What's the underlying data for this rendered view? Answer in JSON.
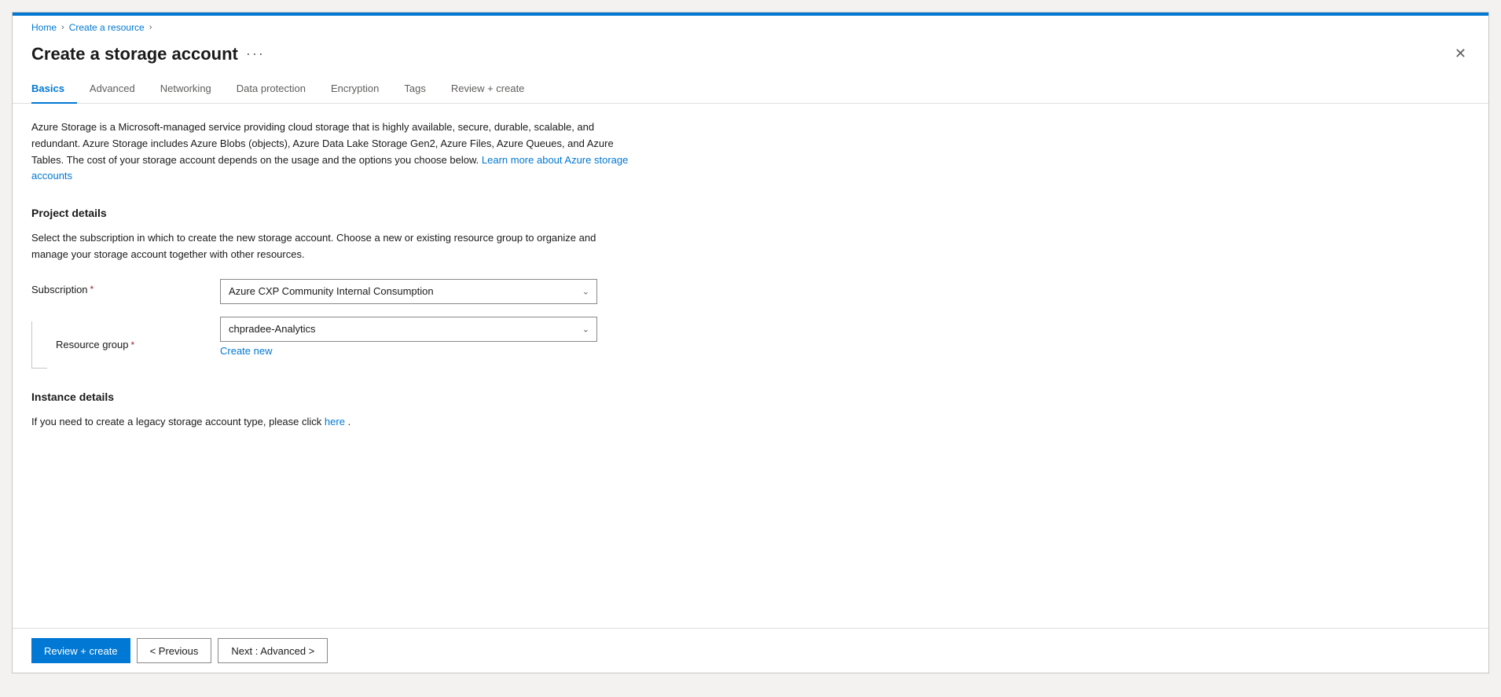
{
  "breadcrumb": {
    "home": "Home",
    "create_resource": "Create a resource",
    "chevron1": "›",
    "chevron2": "›"
  },
  "title": "Create a storage account",
  "title_dots": "···",
  "tabs": [
    {
      "label": "Basics",
      "active": true
    },
    {
      "label": "Advanced",
      "active": false
    },
    {
      "label": "Networking",
      "active": false
    },
    {
      "label": "Data protection",
      "active": false
    },
    {
      "label": "Encryption",
      "active": false
    },
    {
      "label": "Tags",
      "active": false
    },
    {
      "label": "Review + create",
      "active": false
    }
  ],
  "description": {
    "text": "Azure Storage is a Microsoft-managed service providing cloud storage that is highly available, secure, durable, scalable, and redundant. Azure Storage includes Azure Blobs (objects), Azure Data Lake Storage Gen2, Azure Files, Azure Queues, and Azure Tables. The cost of your storage account depends on the usage and the options you choose below.",
    "link_text": "Learn more about Azure storage accounts",
    "link_url": "#"
  },
  "project_details": {
    "heading": "Project details",
    "description": "Select the subscription in which to create the new storage account. Choose a new or existing resource group to organize and manage your storage account together with other resources.",
    "subscription_label": "Subscription",
    "subscription_value": "Azure CXP Community Internal Consumption",
    "resource_group_label": "Resource group",
    "resource_group_value": "chpradee-Analytics",
    "create_new_label": "Create new"
  },
  "instance_details": {
    "heading": "Instance details",
    "description_prefix": "If you need to create a legacy storage account type, please click",
    "link_text": "here",
    "description_suffix": "."
  },
  "footer": {
    "review_create": "Review + create",
    "previous": "< Previous",
    "next": "Next : Advanced >"
  },
  "close_icon": "✕"
}
